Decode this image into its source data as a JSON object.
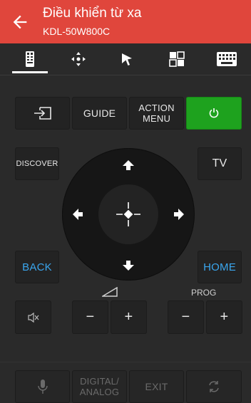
{
  "header": {
    "title": "Điều khiển từ xa",
    "subtitle": "KDL-50W800C",
    "accent_color": "#e0463c",
    "back_icon": "arrow-left-icon"
  },
  "tabs": [
    {
      "name": "remote",
      "icon": "remote-icon",
      "selected": true
    },
    {
      "name": "move",
      "icon": "move-icon",
      "selected": false
    },
    {
      "name": "pointer",
      "icon": "cursor-icon",
      "selected": false
    },
    {
      "name": "apps",
      "icon": "apps-grid-icon",
      "selected": false
    },
    {
      "name": "keyboard",
      "icon": "keyboard-icon",
      "selected": false
    }
  ],
  "buttons": {
    "input_icon": "input-source-icon",
    "guide": "GUIDE",
    "action_menu": "ACTION\nMENU",
    "power_icon": "power-icon",
    "power_color": "#1ea21e",
    "discover": "DISCOVER",
    "tv": "TV",
    "back": "BACK",
    "home": "HOME",
    "blue_color": "#3aa6ee",
    "mute_icon": "mute-icon",
    "vol_minus": "−",
    "vol_plus": "+",
    "prog_label": "PROG",
    "prog_minus": "−",
    "prog_plus": "+",
    "volume_icon": "volume-ramp-icon"
  },
  "bottom": {
    "mic_icon": "microphone-icon",
    "digital_analog": "DIGITAL/\nANALOG",
    "exit": "EXIT",
    "sync_icon": "sync-icon"
  }
}
